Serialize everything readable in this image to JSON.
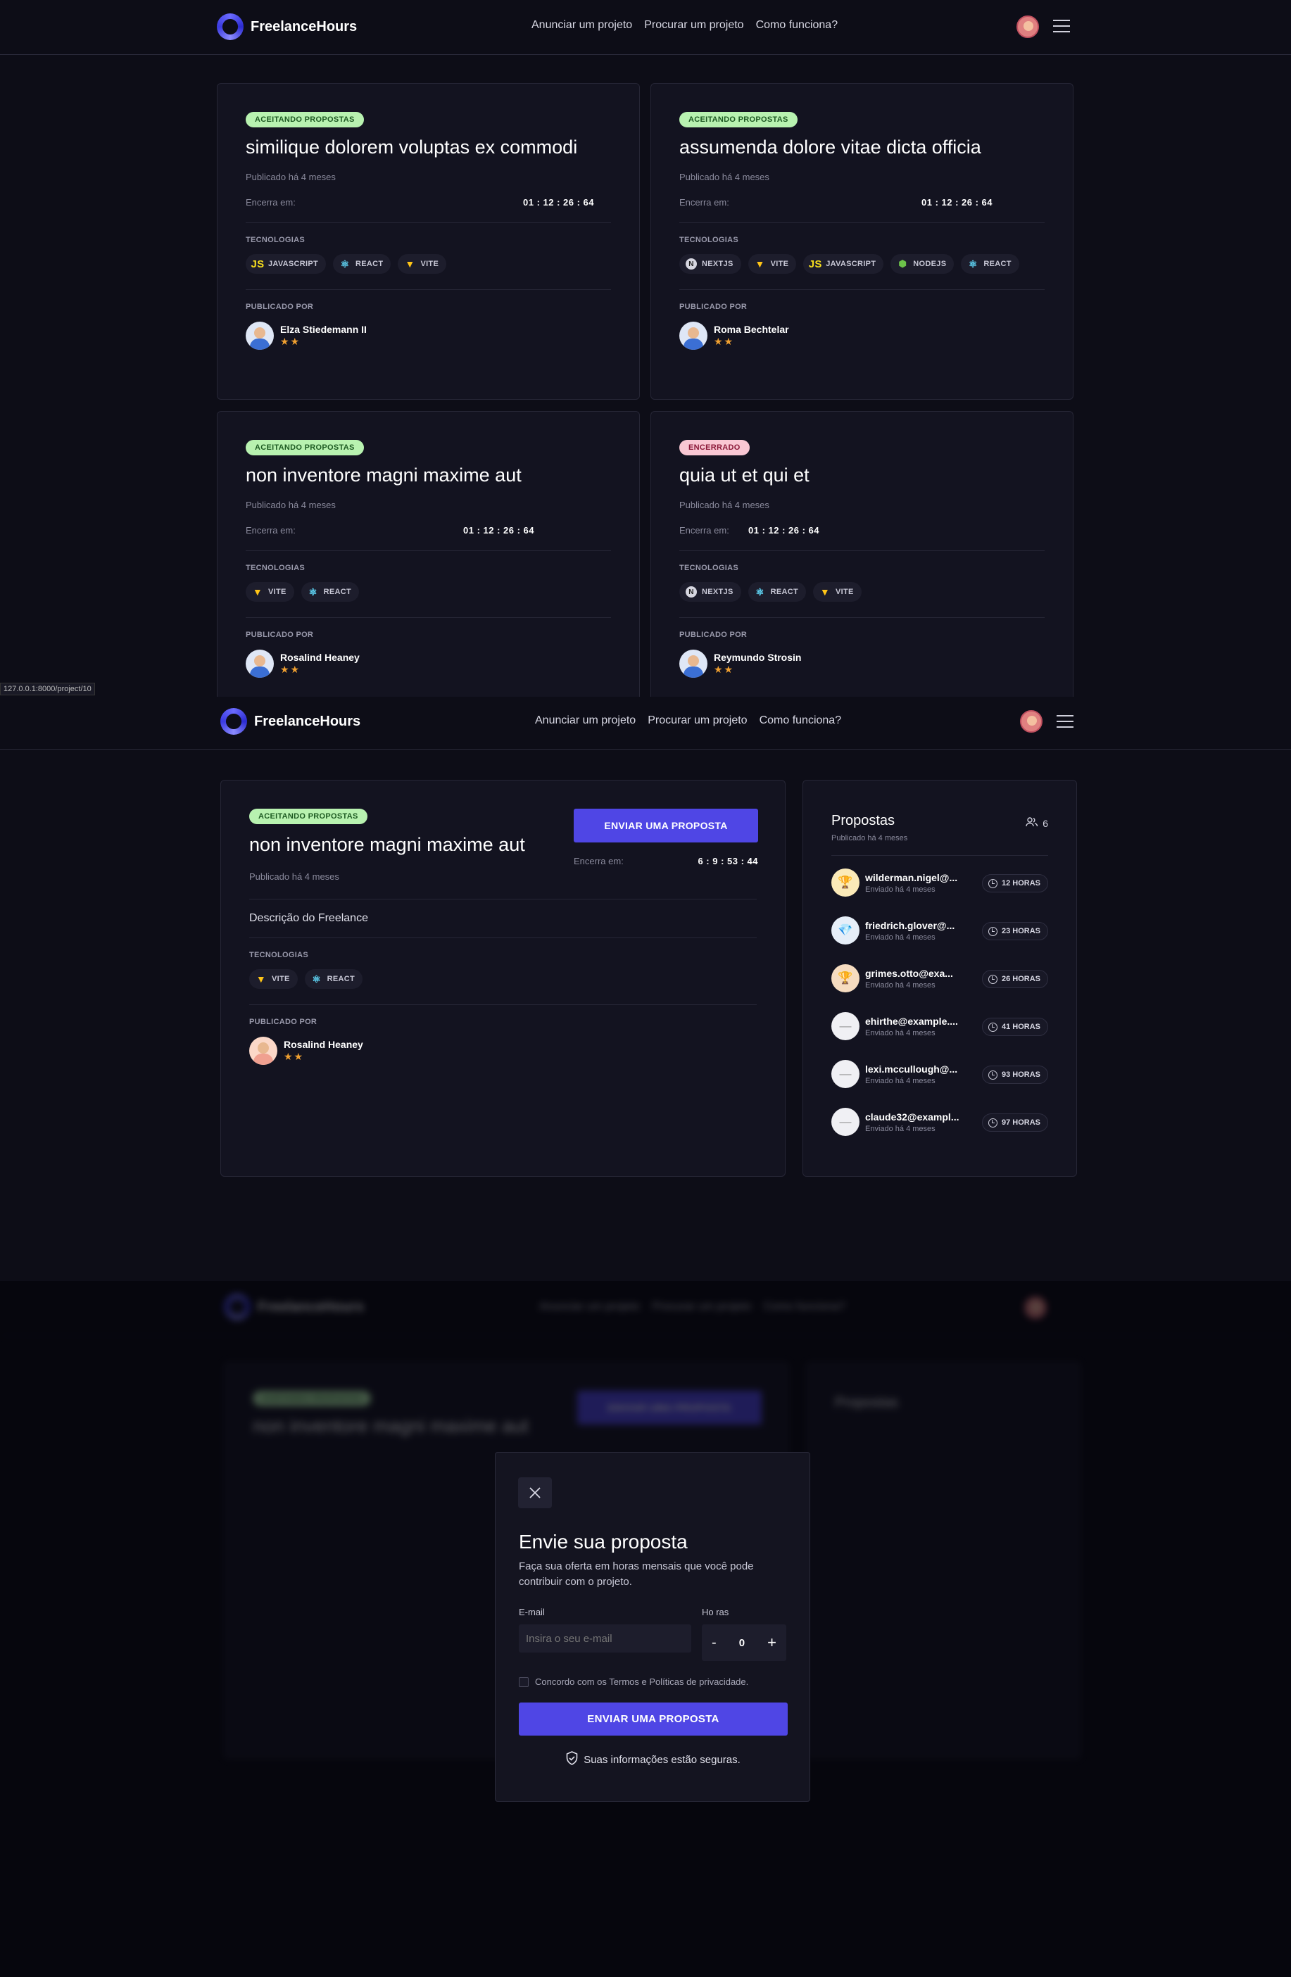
{
  "brand": {
    "name": "FreelanceHours"
  },
  "nav": {
    "links": [
      "Anunciar um projeto",
      "Procurar um projeto",
      "Como funciona?"
    ]
  },
  "listing": {
    "labels": {
      "published_prefix": "Publicado há 4 meses",
      "ends": "Encerra em:",
      "technologies": "TECNOLOGIAS",
      "published_by": "PUBLICADO POR"
    },
    "cards": [
      {
        "status": "ACEITANDO PROPOSTAS",
        "title": "similique dolorem voluptas ex commodi",
        "published": "Publicado há 4 meses",
        "ends_label": "Encerra em:",
        "time": "01 : 12 : 26 : 64",
        "techs": [
          "JAVASCRIPT",
          "REACT",
          "VITE"
        ],
        "author": "Elza Stiedemann II",
        "stars": "★★"
      },
      {
        "status": "ACEITANDO PROPOSTAS",
        "title": "assumenda dolore vitae dicta officia",
        "published": "Publicado há 4 meses",
        "ends_label": "Encerra em:",
        "time": "01 : 12 : 26 : 64",
        "techs": [
          "NEXTJS",
          "VITE",
          "JAVASCRIPT",
          "NODEJS",
          "REACT"
        ],
        "author": "Roma Bechtelar",
        "stars": "★★"
      },
      {
        "status": "ACEITANDO PROPOSTAS",
        "title": "non inventore magni maxime aut",
        "published": "Publicado há 4 meses",
        "ends_label": "Encerra em:",
        "time": "01 : 12 : 26 : 64",
        "techs": [
          "VITE",
          "REACT"
        ],
        "author": "Rosalind Heaney",
        "stars": "★★"
      },
      {
        "status": "ENCERRADO",
        "title": "quia ut et qui et",
        "published": "Publicado há 4 meses",
        "ends_label": "Encerra em:",
        "time": "01 : 12 : 26 : 64",
        "techs": [
          "NEXTJS",
          "REACT",
          "VITE"
        ],
        "author": "Reymundo Strosin",
        "stars": "★★"
      }
    ],
    "status_url": "127.0.0.1:8000/project/10"
  },
  "project": {
    "status": "ACEITANDO PROPOSTAS",
    "title": "non inventore magni maxime aut",
    "published": "Publicado há 4 meses",
    "cta": "ENVIAR UMA PROPOSTA",
    "ends_label": "Encerra em:",
    "time": "6 : 9 : 53 : 44",
    "description": "Descrição do Freelance",
    "tech_label": "TECNOLOGIAS",
    "techs": [
      "VITE",
      "REACT"
    ],
    "author_label": "PUBLICADO POR",
    "author": "Rosalind Heaney",
    "stars": "★★"
  },
  "proposals": {
    "title": "Propostas",
    "subtitle": "Publicado há 4 meses",
    "count": "6",
    "items": [
      {
        "email": "wilderman.nigel@...",
        "sent": "Enviado há 4 meses",
        "hours": "12 HORAS",
        "icon": "trophy-gold-icon"
      },
      {
        "email": "friedrich.glover@...",
        "sent": "Enviado há 4 meses",
        "hours": "23 HORAS",
        "icon": "diamond-icon"
      },
      {
        "email": "grimes.otto@exa...",
        "sent": "Enviado há 4 meses",
        "hours": "26 HORAS",
        "icon": "trophy-bronze-icon"
      },
      {
        "email": "ehirthe@example....",
        "sent": "Enviado há 4 meses",
        "hours": "41 HORAS",
        "icon": "dash-icon"
      },
      {
        "email": "lexi.mccullough@...",
        "sent": "Enviado há 4 meses",
        "hours": "93 HORAS",
        "icon": "dash-icon"
      },
      {
        "email": "claude32@exampl...",
        "sent": "Enviado há 4 meses",
        "hours": "97 HORAS",
        "icon": "dash-icon"
      }
    ]
  },
  "modal": {
    "title": "Envie sua proposta",
    "subtitle": "Faça sua oferta em horas mensais que você pode contribuir com o projeto.",
    "email_label": "E-mail",
    "email_placeholder": "Insira o seu e-mail",
    "hours_label": "Ho ras",
    "hours_value": "0",
    "minus": "-",
    "plus": "+",
    "terms": "Concordo com os Termos e Políticas de privacidade.",
    "submit": "ENVIAR UMA PROPOSTA",
    "secure": "Suas informações estão seguras."
  },
  "colors": {
    "accent": "#4f46e5",
    "badge_green": "#b8f2b0",
    "badge_red": "#f9c7d3",
    "star": "#f0a030"
  }
}
